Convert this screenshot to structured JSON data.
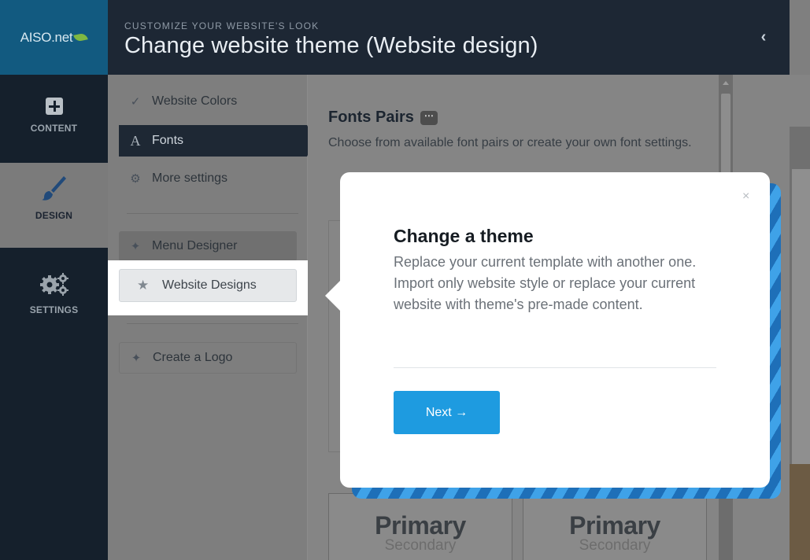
{
  "header": {
    "logo": "AISO.net",
    "subtitle": "CUSTOMIZE YOUR WEBSITE'S LOOK",
    "title": "Change website theme (Website design)",
    "collapse_icon": "chevron-left-icon"
  },
  "nav": {
    "items": [
      {
        "label": "CONTENT",
        "icon": "plus-square-icon"
      },
      {
        "label": "DESIGN",
        "icon": "paintbrush-icon",
        "active": true
      },
      {
        "label": "SETTINGS",
        "icon": "gears-icon"
      }
    ]
  },
  "submenu": {
    "website_colors": "Website Colors",
    "fonts": "Fonts",
    "more_settings": "More settings",
    "menu_designer": "Menu Designer",
    "website_designs": "Website Designs",
    "create_logo": "Create a Logo"
  },
  "main": {
    "section_title": "Fonts Pairs",
    "section_desc": "Choose from available font pairs or create your own font settings.",
    "cards": [
      {
        "primary": "Primary",
        "secondary": "Secondary"
      },
      {
        "primary": "Primary",
        "secondary": "Secondary"
      }
    ]
  },
  "popover": {
    "close": "×",
    "title": "Change a theme",
    "text": "Replace your current template with another one. Import only website style or replace your current website with theme's pre-made content.",
    "next": "Next →"
  },
  "colors": {
    "header_bg": "#1d2734",
    "logo_bg": "#125a80",
    "accent": "#1e9be0",
    "stripe_dark": "#1e6fb8",
    "stripe_light": "#3fa2e8"
  }
}
